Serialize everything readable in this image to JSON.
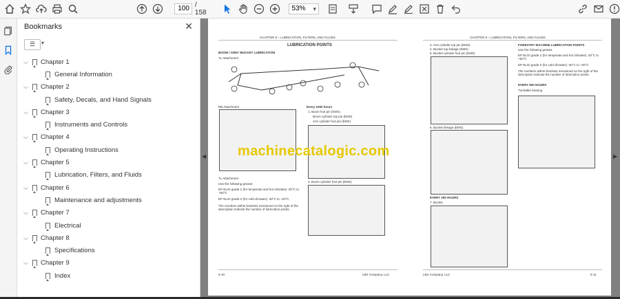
{
  "toolbar": {
    "current_page": "100",
    "total_pages": "/ 158",
    "zoom": "53%"
  },
  "bookmarks": {
    "title": "Bookmarks",
    "items": [
      {
        "chapter": "Chapter 1",
        "sub": "General Information"
      },
      {
        "chapter": "Chapter 2",
        "sub": "Safety, Decals, and Hand Signals"
      },
      {
        "chapter": "Chapter 3",
        "sub": "Instruments and Controls"
      },
      {
        "chapter": "Chapter 4",
        "sub": "Operating Instructions"
      },
      {
        "chapter": "Chapter 5",
        "sub": "Lubrication, Filters, and Fluids"
      },
      {
        "chapter": "Chapter 6",
        "sub": "Maintenance and adjustments"
      },
      {
        "chapter": "Chapter 7",
        "sub": "Electrical"
      },
      {
        "chapter": "Chapter 8",
        "sub": "Specifications"
      },
      {
        "chapter": "Chapter 9",
        "sub": "Index"
      }
    ]
  },
  "document": {
    "header_left": "CHAPTER 5 – LUBRICATION, FILTERS, AND FLUIDS",
    "header_right": "CHAPTER 5 – LUBRICATION, FILTERS, AND FLUIDS",
    "lub_points_title": "LUBRICATION POINTS",
    "boom_title": "BOOM / ARM / BUCKET LUBRICATION",
    "tl_attachment": "TL Attachment",
    "rb_attachment": "RB Attachment",
    "every_1000": "Every 1000 hours",
    "boom_foot_pin": "1. Boom foot pin (EMS)",
    "boom_cyl_top": "Boom cylinder top pin (EMS)",
    "arm_cyl_foot": "Arm cylinder foot pin (EMS)",
    "boom_cyl_foot": "2. Boom cylinder foot pin (EMS)",
    "grease_intro": "Use the following grease:",
    "grease_temp": "EP NLGI grade 2 (for temperate and hot climates) -20°C to +60°C",
    "grease_cold": "EP NLGI grade 0 (for cold climates) -40°C to +20°C",
    "brackets_note": "The numbers within brackets mentioned on the right of the description indicate the number of lubrication points.",
    "arm_cyl_top": "3. Arm cylinder top pin (EMS)",
    "bucket_top_link": "4. Bucket top linkage (EMS)",
    "bucket_cyl_foot": "5. Bucket cylinder foot pin (EMS)",
    "bucket_linkage": "6. Bucket linkage (EMS)",
    "every_250": "EVERY 250 HOURS",
    "bucket": "7. Bucket",
    "forestry_title": "FORESTRY MACHINE LUBRICATION POINTS",
    "every_500": "EVERY 500 HOURS",
    "turntable": "Turntable bearing",
    "page_left": "5-10",
    "page_right": "5-11",
    "company": "LBX Company, LLC",
    "watermark": "machinecatalogic.com"
  }
}
